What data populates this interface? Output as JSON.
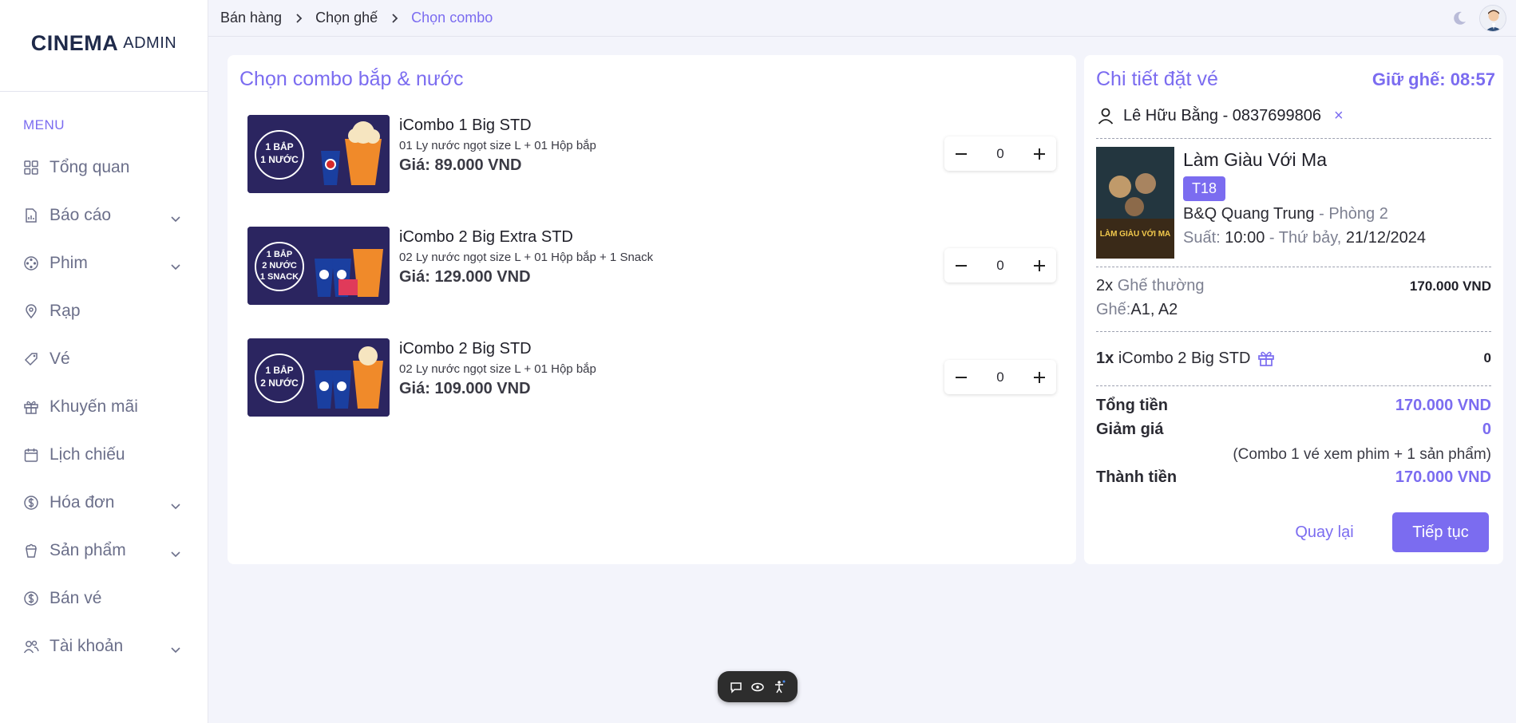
{
  "logo": {
    "brand": "CINEMA",
    "suffix": "ADMIN"
  },
  "sidebar": {
    "menu_title": "MENU",
    "items": [
      {
        "label": "Tổng quan",
        "icon": "grid-icon",
        "has_children": false
      },
      {
        "label": "Báo cáo",
        "icon": "report-icon",
        "has_children": true
      },
      {
        "label": "Phim",
        "icon": "film-reel-icon",
        "has_children": true
      },
      {
        "label": "Rạp",
        "icon": "map-pin-icon",
        "has_children": false
      },
      {
        "label": "Vé",
        "icon": "ticket-icon",
        "has_children": false
      },
      {
        "label": "Khuyến mãi",
        "icon": "gift-icon",
        "has_children": false
      },
      {
        "label": "Lịch chiếu",
        "icon": "calendar-icon",
        "has_children": false
      },
      {
        "label": "Hóa đơn",
        "icon": "dollar-circle-icon",
        "has_children": true
      },
      {
        "label": "Sản phẩm",
        "icon": "popcorn-icon",
        "has_children": true
      },
      {
        "label": "Bán vé",
        "icon": "dollar-circle-icon",
        "has_children": false
      },
      {
        "label": "Tài khoản",
        "icon": "users-icon",
        "has_children": true
      }
    ]
  },
  "breadcrumb": [
    "Bán hàng",
    "Chọn ghế",
    "Chọn combo"
  ],
  "combo_panel": {
    "title": "Chọn combo bắp & nước",
    "combos": [
      {
        "name": "iCombo 1 Big STD",
        "desc": "01 Ly nước ngọt size L + 01 Hộp bắp",
        "price": "Giá: 89.000 VND",
        "qty": "0",
        "img_text": [
          "1 BẮP",
          "1 NƯỚC"
        ]
      },
      {
        "name": "iCombo 2 Big Extra STD",
        "desc": "02 Ly nước ngọt size L + 01 Hộp bắp + 1 Snack",
        "price": "Giá: 129.000 VND",
        "qty": "0",
        "img_text": [
          "1 BẮP",
          "2 NƯỚC",
          "1 SNACK"
        ]
      },
      {
        "name": "iCombo 2 Big STD",
        "desc": "02 Ly nước ngọt size L + 01 Hộp bắp",
        "price": "Giá: 109.000 VND",
        "qty": "0",
        "img_text": [
          "1 BẮP",
          "2 NƯỚC"
        ]
      }
    ]
  },
  "details": {
    "title": "Chi tiết đặt vé",
    "hold": "Giữ ghế: 08:57",
    "customer": "Lê Hữu Bằng - 0837699806",
    "remove": "×",
    "movie": {
      "title": "Làm Giàu Với Ma",
      "rating": "T18",
      "cinema": "B&Q Quang Trung",
      "room_sep": " - ",
      "room": "Phòng 2",
      "showtime_label": "Suất: ",
      "time": "10:00",
      "day_sep": " - Thứ bảy, ",
      "date": "21/12/2024",
      "poster_text": "LÀM GIÀU VỚI MA"
    },
    "seat_line": {
      "qty": "2x",
      "type": "Ghế thường",
      "amount": "170.000 VND"
    },
    "seat_list": {
      "label": "Ghế: ",
      "value": "A1, A2"
    },
    "combo_line": {
      "qty": "1x",
      "name": "iCombo 2 Big STD",
      "amount": "0"
    },
    "total_label": "Tổng tiền",
    "total": "170.000 VND",
    "discount_label": "Giảm giá",
    "discount": "0",
    "promo_note": "(Combo 1 vé xem phim + 1 sản phẩm)",
    "final_label": "Thành tiền",
    "final": "170.000 VND",
    "back": "Quay lại",
    "next": "Tiếp tục"
  },
  "colors": {
    "accent": "#7b6cf0",
    "bg": "#f3f4fb"
  }
}
